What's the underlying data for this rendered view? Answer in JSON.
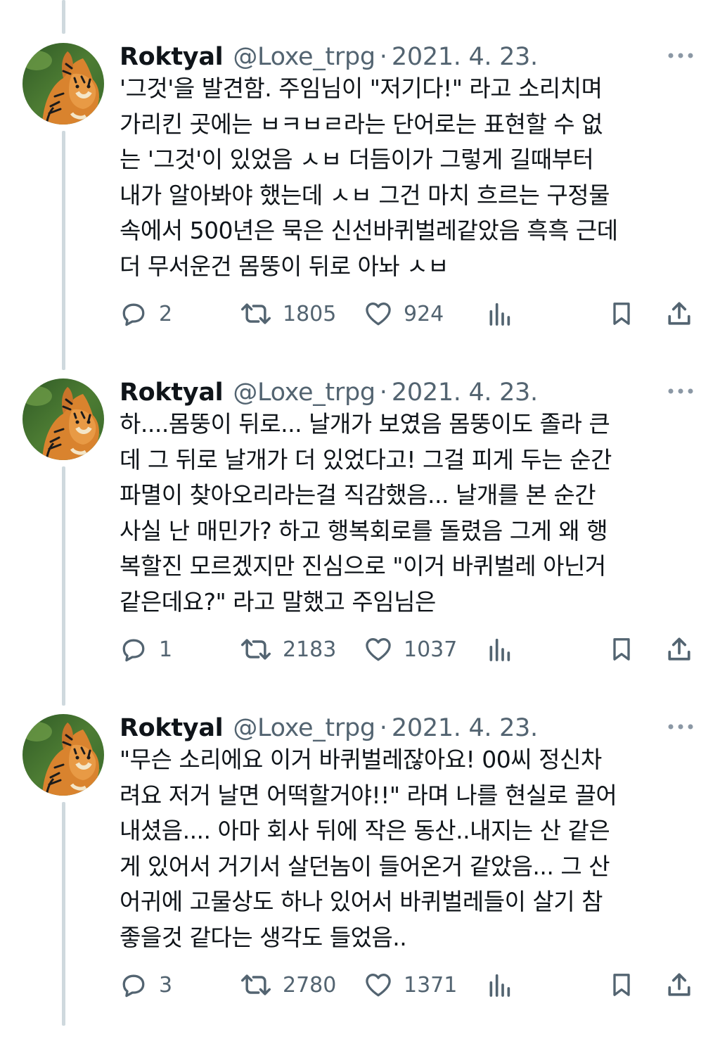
{
  "tweets": [
    {
      "name": "Roktyal",
      "handle": "@Loxe_trpg",
      "date": "2021. 4. 23.",
      "text": "'그것'을 발견함. 주임님이 \"저기다!\" 라고 소리치며\n가리킨 곳에는 ㅂㅋㅂㄹ라는 단어로는 표현할 수 없\n는 '그것'이 있었음 ㅅㅂ 더듬이가 그렇게 길때부터\n내가 알아봐야 했는데 ㅅㅂ 그건 마치 흐르는 구정물\n속에서 500년은 묵은 신선바퀴벌레같았음 흑흑 근데\n더 무서운건 몸뚱이 뒤로 아놔 ㅅㅂ",
      "replies": "2",
      "retweets": "1805",
      "likes": "924"
    },
    {
      "name": "Roktyal",
      "handle": "@Loxe_trpg",
      "date": "2021. 4. 23.",
      "text": "하....몸뚱이 뒤로... 날개가 보였음 몸뚱이도 졸라 큰\n데 그 뒤로 날개가 더 있었다고! 그걸 피게 두는 순간\n파멸이 찾아오리라는걸 직감했음... 날개를 본 순간\n사실 난 매민가? 하고 행복회로를 돌렸음 그게 왜 행\n복할진 모르겠지만 진심으로 \"이거 바퀴벌레 아닌거\n같은데요?\" 라고 말했고 주임님은",
      "replies": "1",
      "retweets": "2183",
      "likes": "1037"
    },
    {
      "name": "Roktyal",
      "handle": "@Loxe_trpg",
      "date": "2021. 4. 23.",
      "text": "\"무슨 소리에요 이거 바퀴벌레잖아요! 00씨 정신차\n려요 저거 날면 어떡할거야!!\" 라며 나를 현실로 끌어\n내셨음.... 아마 회사 뒤에 작은 동산..내지는 산 같은\n게 있어서 거기서 살던놈이 들어온거 같았음... 그 산\n어귀에 고물상도 하나 있어서 바퀴벌레들이 살기 참\n좋을것 같다는 생각도 들었음..",
      "replies": "3",
      "retweets": "2780",
      "likes": "1371"
    }
  ],
  "icons": {
    "reply": "reply-bubble-icon",
    "retweet": "retweet-arrows-icon",
    "like": "heart-icon",
    "views": "views-bar-chart-icon",
    "bookmark": "bookmark-icon",
    "share": "share-upload-icon",
    "more": "more-dots-icon",
    "avatar": "tiger-avatar"
  },
  "colors": {
    "text": "#0f1419",
    "secondary": "#536471",
    "thread_line": "#cfd9de",
    "background": "#ffffff"
  }
}
